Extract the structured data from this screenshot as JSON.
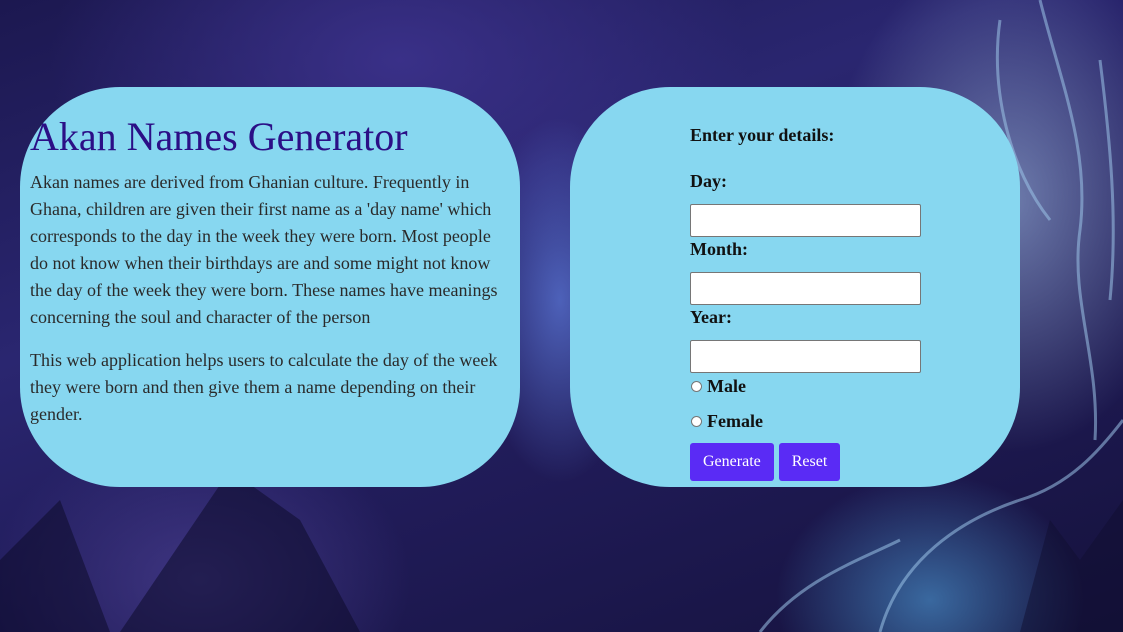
{
  "intro": {
    "title": "Akan Names Generator",
    "paragraphs": [
      "Akan names are derived from Ghanian culture. Frequently in Ghana, children are given their first name as a 'day name' which corresponds to the day in the week they were born. Most people do not know when their birthdays are and some might not know the day of the week they were born. These names have meanings concerning the soul and character of the person",
      "This web application helps users to calculate the day of the week they were born and then give them a name depending on their gender."
    ]
  },
  "form": {
    "heading": "Enter your details:",
    "day_label": "Day:",
    "day_value": "",
    "month_label": "Month:",
    "month_value": "",
    "year_label": "Year:",
    "year_value": "",
    "gender_options": [
      "Male",
      "Female"
    ],
    "generate_label": "Generate",
    "reset_label": "Reset"
  },
  "colors": {
    "card_background": "#87d7f0",
    "title": "#2b0f86",
    "button": "#5a2bf5"
  }
}
